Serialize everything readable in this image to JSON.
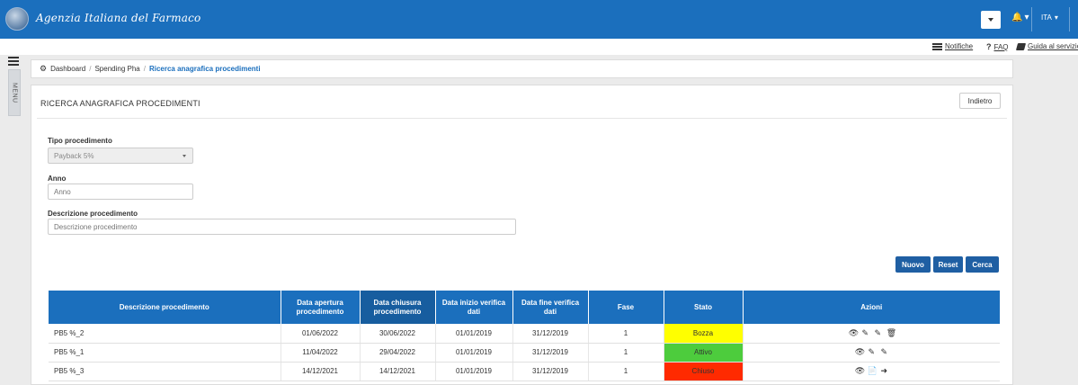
{
  "header": {
    "brand": "Agenzia Italiana del Farmaco",
    "lang": "ITA",
    "caret": "▾"
  },
  "util_links": {
    "notifiche": "Notifiche",
    "faq": "FAQ",
    "guida": "Guida al servizio"
  },
  "menu_tab": "MENU",
  "breadcrumb": {
    "items": [
      "Dashboard",
      "Spending Pha",
      "Ricerca anagrafica procedimenti"
    ],
    "separator": "/"
  },
  "panel": {
    "title": "RICERCA ANAGRAFICA PROCEDIMENTI",
    "back_label": "Indietro"
  },
  "form": {
    "tipo_label": "Tipo procedimento",
    "tipo_value": "Payback 5%",
    "anno_label": "Anno",
    "anno_placeholder": "Anno",
    "descr_label": "Descrizione procedimento",
    "descr_placeholder": "Descrizione procedimento"
  },
  "actions": {
    "nuovo": "Nuovo",
    "reset": "Reset",
    "cerca": "Cerca"
  },
  "table": {
    "headers": [
      "Descrizione procedimento",
      "Data apertura procedimento",
      "Data chiusura procedimento",
      "Data inizio verifica dati",
      "Data fine verifica dati",
      "Fase",
      "Stato",
      "Azioni"
    ],
    "rows": [
      {
        "descr": "PB5 %_2",
        "apertura": "01/06/2022",
        "chiusura": "30/06/2022",
        "inizio": "01/01/2019",
        "fine": "31/12/2019",
        "fase": "1",
        "stato": "Bozza"
      },
      {
        "descr": "PB5 %_1",
        "apertura": "11/04/2022",
        "chiusura": "29/04/2022",
        "inizio": "01/01/2019",
        "fine": "31/12/2019",
        "fase": "1",
        "stato": "Attivo"
      },
      {
        "descr": "PB5 %_3",
        "apertura": "14/12/2021",
        "chiusura": "14/12/2021",
        "inizio": "01/01/2019",
        "fine": "31/12/2019",
        "fase": "1",
        "stato": "Chiuso"
      }
    ]
  },
  "colors": {
    "primary": "#1b6fbd",
    "button": "#1f5fa3",
    "bozza": "#ffff00",
    "attivo": "#4dcc3d",
    "chiuso": "#ff2a00"
  },
  "icons": {
    "view": "eye-icon",
    "edit": "pencil-icon",
    "modify": "edit-square-icon",
    "delete": "trash-icon",
    "document": "document-icon",
    "export": "sign-in-icon"
  }
}
